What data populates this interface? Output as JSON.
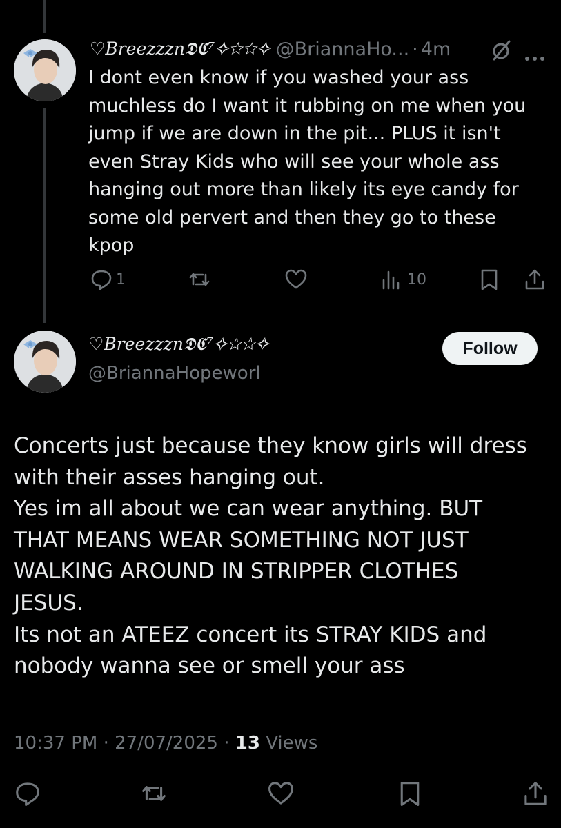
{
  "reply": {
    "display_name": "♡Breezzzn𝕯𝕮⁷✧☆☆✧",
    "handle": "@BriannaHo...",
    "separator": "·",
    "time": "4m",
    "text": "I dont even know if you washed your ass\nmuchless do I want it rubbing on me when you\njump if we are down in the pit... PLUS it isn't\neven Stray Kids who will see your whole ass\nhanging out more than likely its eye candy for\nsome old pervert and then they go to these\nkpop",
    "reply_count": "1",
    "views_count": "10",
    "icons": [
      "muted-icon",
      "more-icon",
      "reply-icon",
      "repost-icon",
      "like-icon",
      "views-icon",
      "bookmark-icon",
      "share-icon"
    ]
  },
  "main": {
    "display_name": "♡Breezzzn𝕯𝕮⁷✧☆☆✧",
    "handle": "@BriannaHopeworl",
    "follow_label": "Follow",
    "text": "Concerts just because they know girls will dress\nwith their asses hanging out.\nYes im all about we can wear anything. BUT\nTHAT MEANS WEAR SOMETHING NOT JUST\nWALKING AROUND IN STRIPPER CLOTHES\nJESUS.\nIts not an ATEEZ concert its STRAY KIDS and\nnobody wanna see or smell your ass",
    "time": "10:37 PM",
    "date": "27/07/2025",
    "separator": "·",
    "views_count": "13",
    "views_label": "Views",
    "icons": [
      "reply-icon",
      "repost-icon",
      "like-icon",
      "bookmark-icon",
      "share-icon"
    ]
  },
  "colors": {
    "background": "#000000",
    "text": "#e7e9ea",
    "muted": "#71767b",
    "thread_line": "#333639",
    "follow_bg": "#eff3f4"
  }
}
